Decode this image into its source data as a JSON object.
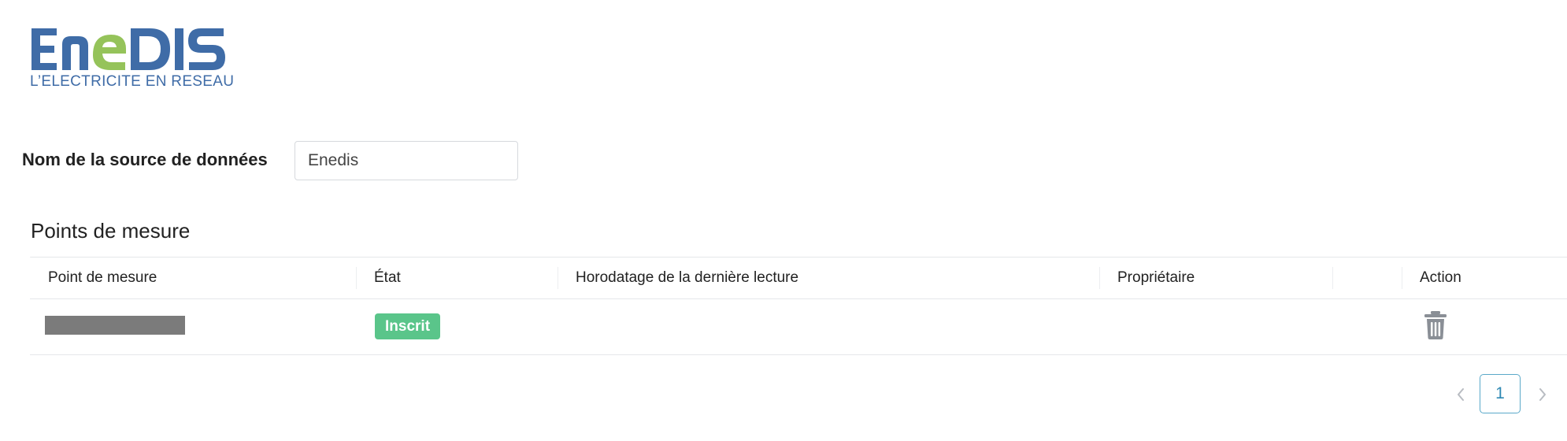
{
  "logo": {
    "wordmark": "ENEDIS",
    "tagline": "L’ELECTRICITE EN RESEAU",
    "colors": {
      "blue": "#3f6ca7",
      "green": "#95c35a"
    }
  },
  "form": {
    "source_label": "Nom de la source de données",
    "source_value": "Enedis"
  },
  "section": {
    "title": "Points de mesure"
  },
  "table": {
    "columns": [
      "Point de mesure",
      "État",
      "Horodatage de la dernière lecture",
      "Propriétaire",
      "",
      "Action"
    ],
    "rows": [
      {
        "point_de_mesure": "",
        "etat": "Inscrit",
        "horodatage": "",
        "proprietaire": "",
        "action_icon": "trash-icon"
      }
    ]
  },
  "pagination": {
    "current_page": "1",
    "prev_icon": "chevron-left-icon",
    "next_icon": "chevron-right-icon"
  },
  "colors": {
    "status_inscrit": "#5ac58a",
    "page_active": "#2e88b3"
  }
}
